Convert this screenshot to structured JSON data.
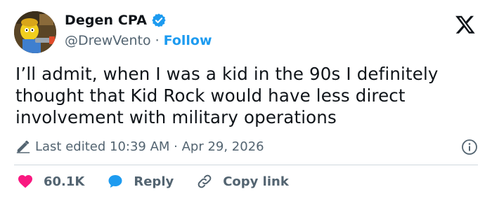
{
  "header": {
    "display_name": "Degen CPA",
    "handle": "@DrewVento",
    "separator": "·",
    "follow_label": "Follow"
  },
  "tweet": {
    "text": "I’ll admit, when I was a kid in the 90s I definitely thought that Kid Rock would have less direct involvement with military operations"
  },
  "meta": {
    "edited_text": "Last edited 10:39 AM · Apr 29, 2026"
  },
  "actions": {
    "like_count": "60.1K",
    "reply_label": "Reply",
    "copy_link_label": "Copy link"
  },
  "colors": {
    "accent": "#1d9bf0",
    "like": "#f91880",
    "text": "#0f1419",
    "muted": "#536471"
  },
  "icons": {
    "logo": "x-logo-icon",
    "verified": "verified-badge-icon",
    "edit": "pencil-icon",
    "info": "info-icon",
    "like": "heart-icon",
    "reply": "reply-bubble-icon",
    "copy": "link-icon"
  }
}
